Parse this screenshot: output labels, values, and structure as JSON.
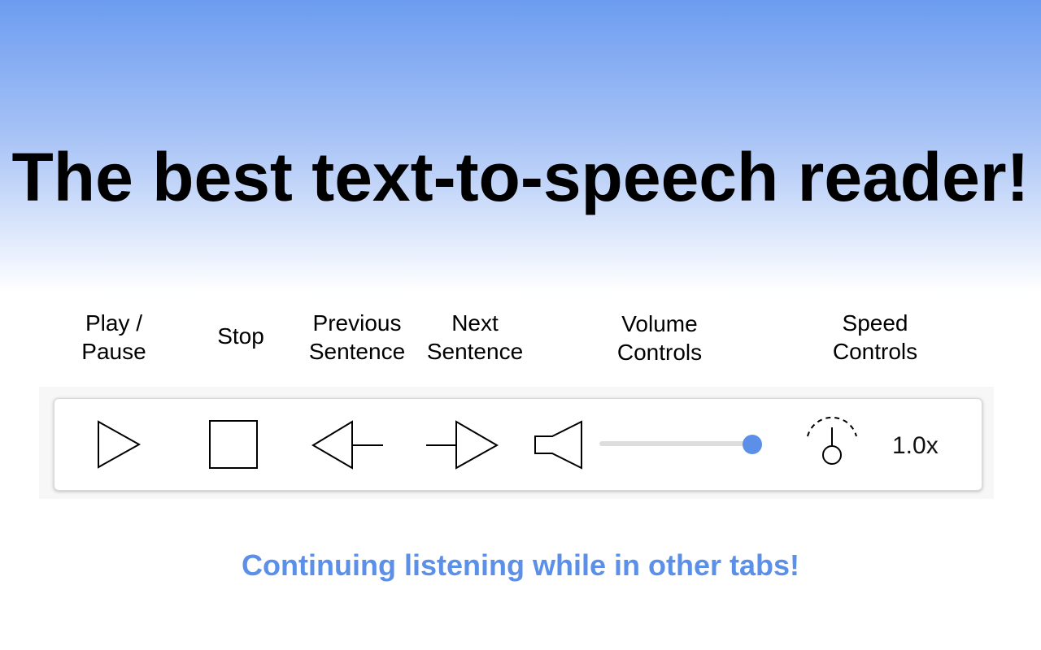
{
  "colors": {
    "accent": "#5b8fe8",
    "gradient_top": "#6c9cf0"
  },
  "headline": "The best text-to-speech reader!",
  "labels": {
    "play_pause": "Play /\nPause",
    "stop": "Stop",
    "previous": "Previous\nSentence",
    "next": "Next\nSentence",
    "volume": "Volume\nControls",
    "speed": "Speed\nControls"
  },
  "toolbar": {
    "icons": [
      "play-icon",
      "stop-icon",
      "previous-sentence-icon",
      "next-sentence-icon",
      "speaker-icon",
      "speed-dial-icon"
    ],
    "volume_level": 1.0,
    "speed_value": "1.0x"
  },
  "tagline": "Continuing listening while in other tabs!"
}
